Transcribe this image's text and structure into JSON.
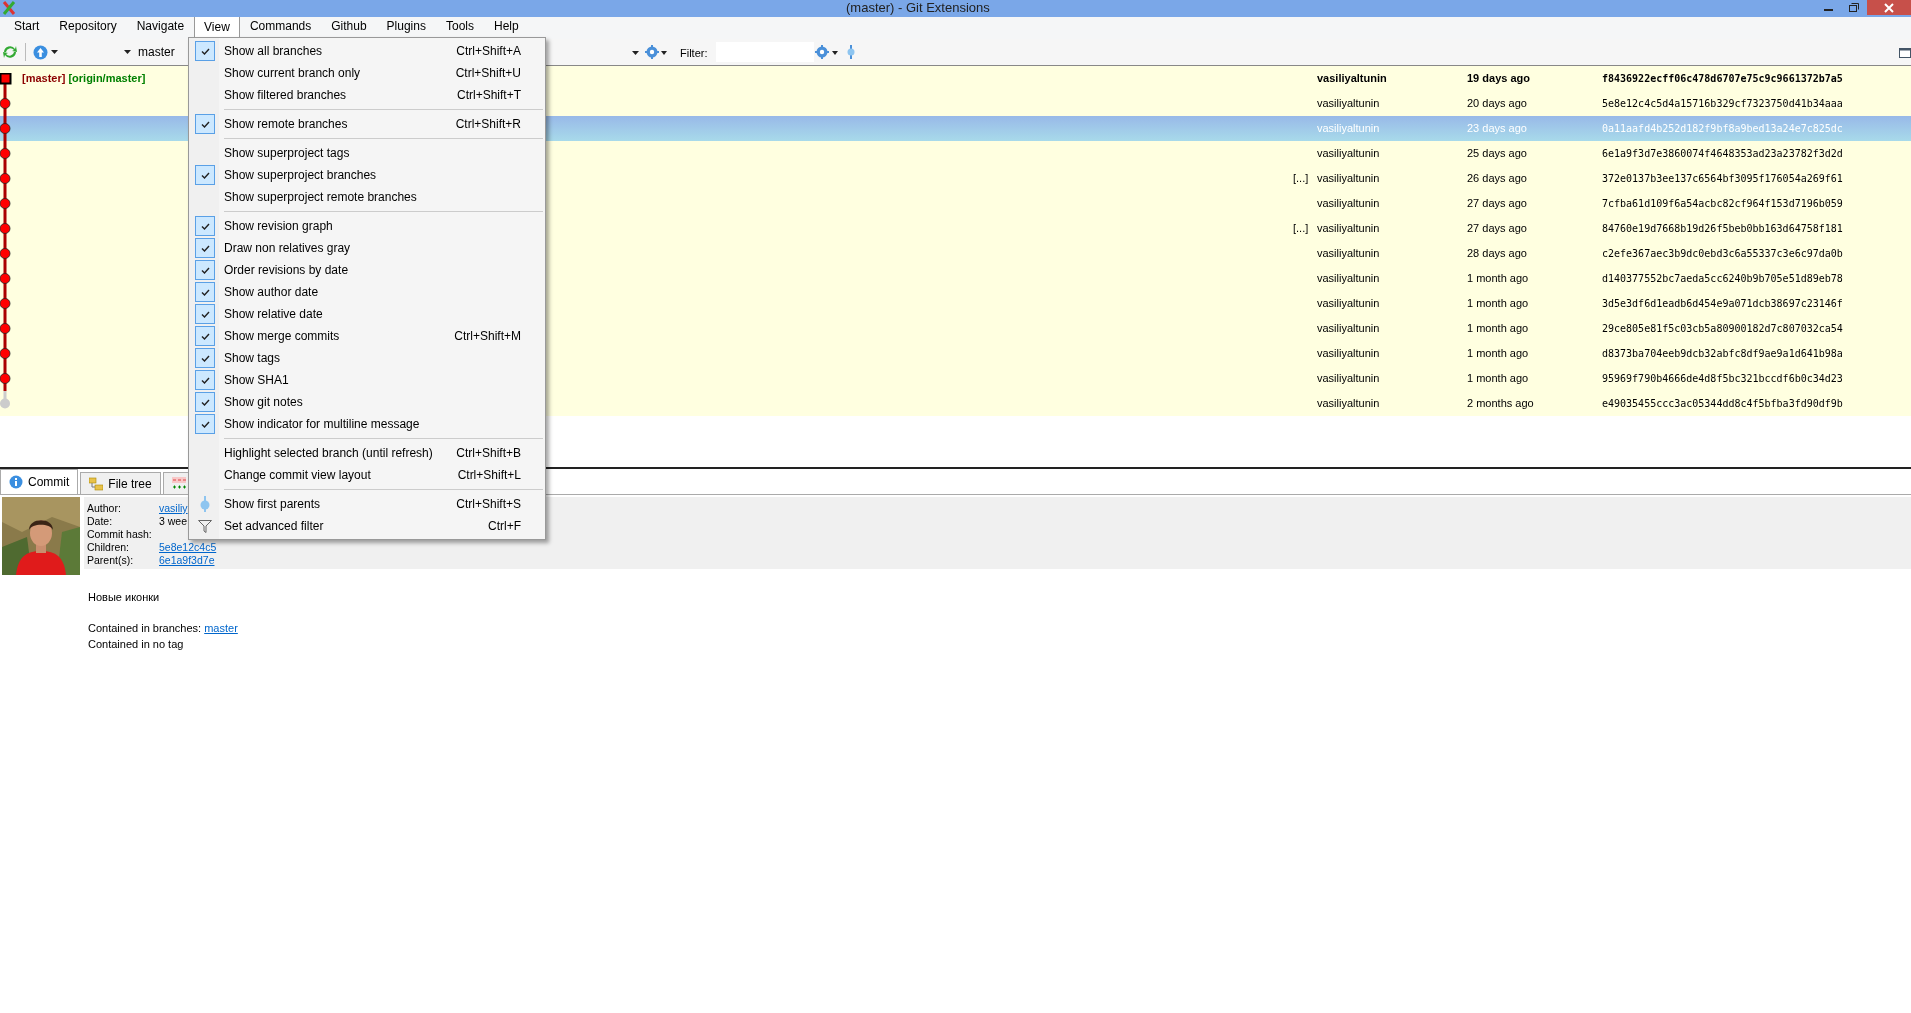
{
  "window": {
    "title": "(master) - Git Extensions"
  },
  "menu_bar": [
    {
      "label": "Start",
      "selected": false
    },
    {
      "label": "Repository",
      "selected": false
    },
    {
      "label": "Navigate",
      "selected": false
    },
    {
      "label": "View",
      "selected": true
    },
    {
      "label": "Commands",
      "selected": false
    },
    {
      "label": "Github",
      "selected": false
    },
    {
      "label": "Plugins",
      "selected": false
    },
    {
      "label": "Tools",
      "selected": false
    },
    {
      "label": "Help",
      "selected": false
    }
  ],
  "toolbar": {
    "branch": "master",
    "filter_label": "Filter:"
  },
  "view_menu": [
    {
      "kind": "item",
      "label": "Show all branches",
      "shortcut": "Ctrl+Shift+A",
      "checked": true
    },
    {
      "kind": "item",
      "label": "Show current branch only",
      "shortcut": "Ctrl+Shift+U",
      "checked": false
    },
    {
      "kind": "item",
      "label": "Show filtered branches",
      "shortcut": "Ctrl+Shift+T",
      "checked": false
    },
    {
      "kind": "separator"
    },
    {
      "kind": "item",
      "label": "Show remote branches",
      "shortcut": "Ctrl+Shift+R",
      "checked": true
    },
    {
      "kind": "separator"
    },
    {
      "kind": "item",
      "label": "Show superproject tags",
      "checked": false
    },
    {
      "kind": "item",
      "label": "Show superproject branches",
      "checked": true
    },
    {
      "kind": "item",
      "label": "Show superproject remote branches",
      "checked": false
    },
    {
      "kind": "separator"
    },
    {
      "kind": "item",
      "label": "Show revision graph",
      "checked": true
    },
    {
      "kind": "item",
      "label": "Draw non relatives gray",
      "checked": true
    },
    {
      "kind": "item",
      "label": "Order revisions by date",
      "checked": true
    },
    {
      "kind": "item",
      "label": "Show author date",
      "checked": true
    },
    {
      "kind": "item",
      "label": "Show relative date",
      "checked": true
    },
    {
      "kind": "item",
      "label": "Show merge commits",
      "shortcut": "Ctrl+Shift+M",
      "checked": true
    },
    {
      "kind": "item",
      "label": "Show tags",
      "checked": true
    },
    {
      "kind": "item",
      "label": "Show SHA1",
      "checked": true
    },
    {
      "kind": "item",
      "label": "Show git notes",
      "checked": true
    },
    {
      "kind": "item",
      "label": "Show indicator for multiline message",
      "checked": true
    },
    {
      "kind": "separator"
    },
    {
      "kind": "item",
      "label": "Highlight selected branch (until refresh)",
      "shortcut": "Ctrl+Shift+B",
      "checked": false
    },
    {
      "kind": "item",
      "label": "Change commit view layout",
      "shortcut": "Ctrl+Shift+L",
      "checked": false
    },
    {
      "kind": "separator"
    },
    {
      "kind": "pin",
      "label": "Show first parents",
      "shortcut": "Ctrl+Shift+S"
    },
    {
      "kind": "filter",
      "label": "Set advanced filter",
      "shortcut": "Ctrl+F"
    }
  ],
  "revisions": [
    {
      "kind": "head",
      "refs": [
        {
          "label": "[master]",
          "kind": "local"
        },
        {
          "label": "[origin/master]",
          "kind": "remote"
        }
      ],
      "author": "vasiliyaltunin",
      "date": "19 days ago",
      "hash": "f8436922ecff06c478d6707e75c9c9661372b7a5",
      "bold": true,
      "selected": false
    },
    {
      "kind": "commit",
      "author": "vasiliyaltunin",
      "date": "20 days ago",
      "hash": "5e8e12c4c5d4a15716b329cf7323750d41b34aaa",
      "bold": false,
      "selected": false
    },
    {
      "kind": "commit",
      "author": "vasiliyaltunin",
      "date": "23 days ago",
      "hash": "0a11aafd4b252d182f9bf8a9bed13a24e7c825dc",
      "bold": false,
      "selected": true
    },
    {
      "kind": "commit",
      "author": "vasiliyaltunin",
      "date": "25 days ago",
      "hash": "6e1a9f3d7e3860074f4648353ad23a23782f3d2d",
      "bold": false,
      "selected": false
    },
    {
      "kind": "commit",
      "marker": "[...]",
      "author": "vasiliyaltunin",
      "date": "26 days ago",
      "hash": "372e0137b3ee137c6564bf3095f176054a269f61",
      "bold": false,
      "selected": false
    },
    {
      "kind": "commit",
      "author": "vasiliyaltunin",
      "date": "27 days ago",
      "hash": "7cfba61d109f6a54acbc82cf964f153d7196b059",
      "bold": false,
      "selected": false
    },
    {
      "kind": "commit",
      "marker": "[...]",
      "author": "vasiliyaltunin",
      "date": "27 days ago",
      "hash": "84760e19d7668b19d26f5beb0bb163d64758f181",
      "bold": false,
      "selected": false
    },
    {
      "kind": "commit",
      "author": "vasiliyaltunin",
      "date": "28 days ago",
      "hash": "c2efe367aec3b9dc0ebd3c6a55337c3e6c97da0b",
      "bold": false,
      "selected": false
    },
    {
      "kind": "commit",
      "author": "vasiliyaltunin",
      "date": "1 month ago",
      "hash": "d140377552bc7aeda5cc6240b9b705e51d89eb78",
      "bold": false,
      "selected": false
    },
    {
      "kind": "commit",
      "author": "vasiliyaltunin",
      "date": "1 month ago",
      "hash": "3d5e3df6d1eadb6d454e9a071dcb38697c23146f",
      "bold": false,
      "selected": false
    },
    {
      "kind": "commit",
      "author": "vasiliyaltunin",
      "date": "1 month ago",
      "hash": "29ce805e81f5c03cb5a80900182d7c807032ca54",
      "bold": false,
      "selected": false
    },
    {
      "kind": "commit",
      "author": "vasiliyaltunin",
      "date": "1 month ago",
      "hash": "d8373ba704eeb9dcb32abfc8df9ae9a1d641b98a",
      "bold": false,
      "selected": false
    },
    {
      "kind": "commit",
      "author": "vasiliyaltunin",
      "date": "1 month ago",
      "hash": "95969f790b4666de4d8f5bc321bccdf6b0c34d23",
      "bold": false,
      "selected": false
    },
    {
      "kind": "gray",
      "author": "vasiliyaltunin",
      "date": "2 months ago",
      "hash": "e49035455ccc3ac05344dd8c4f5bfba3fd90df9b",
      "bold": false,
      "selected": false
    }
  ],
  "detail_tabs": [
    {
      "label": "Commit",
      "selected": true
    },
    {
      "label": "File tree",
      "selected": false
    },
    {
      "selected": false
    }
  ],
  "commit_info": {
    "fields": [
      {
        "label": "Author:",
        "value": "vasiliy",
        "link": true
      },
      {
        "label": "Date:",
        "value": "3 wee",
        "link": false
      },
      {
        "label": "Commit hash:"
      },
      {
        "label": "Children:",
        "value": "5e8e12c4c5",
        "link": true
      },
      {
        "label": "Parent(s):",
        "value": "6e1a9f3d7e",
        "link": true
      }
    ],
    "message": "Новые иконки",
    "branches_label": "Contained in branches:",
    "branch_link": "master",
    "tags": "Contained in no tag"
  }
}
